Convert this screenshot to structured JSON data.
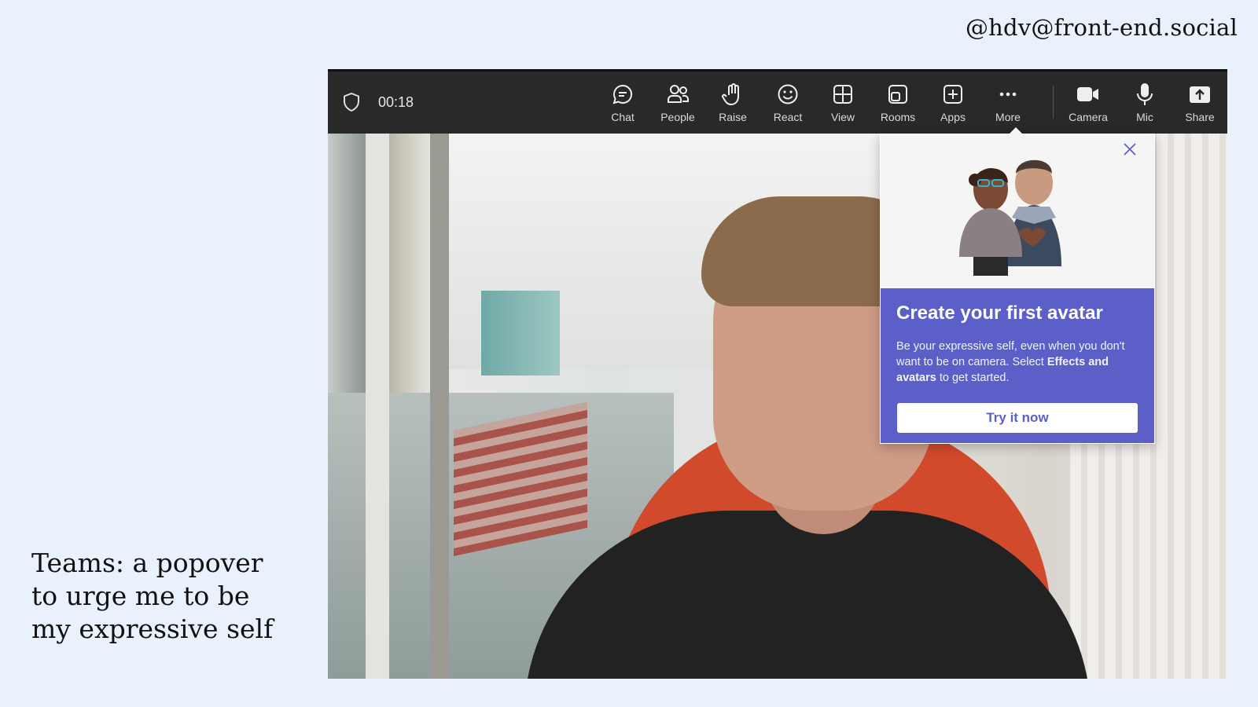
{
  "slide": {
    "handle": "@hdv@front-end.social",
    "caption": "Teams: a popover to urge me to be my expressive self"
  },
  "toolbar": {
    "timer": "00:18",
    "buttons": [
      {
        "label": "Chat",
        "icon": "chat-icon"
      },
      {
        "label": "People",
        "icon": "people-icon"
      },
      {
        "label": "Raise",
        "icon": "hand-icon"
      },
      {
        "label": "React",
        "icon": "smiley-icon"
      },
      {
        "label": "View",
        "icon": "grid-icon"
      },
      {
        "label": "Rooms",
        "icon": "rooms-icon"
      },
      {
        "label": "Apps",
        "icon": "plus-square-icon"
      },
      {
        "label": "More",
        "icon": "ellipsis-icon"
      },
      {
        "label": "Camera",
        "icon": "camera-icon"
      },
      {
        "label": "Mic",
        "icon": "mic-icon"
      },
      {
        "label": "Share",
        "icon": "share-icon"
      }
    ]
  },
  "popover": {
    "title": "Create your first avatar",
    "body_pre": "Be your expressive self, even when you don't want to be on camera. Select ",
    "body_bold": "Effects and avatars",
    "body_post": " to get started.",
    "button": "Try it now"
  },
  "colors": {
    "slide_bg": "#e9f1fd",
    "toolbar_bg": "#292929",
    "popover_accent": "#5b5fc7"
  }
}
